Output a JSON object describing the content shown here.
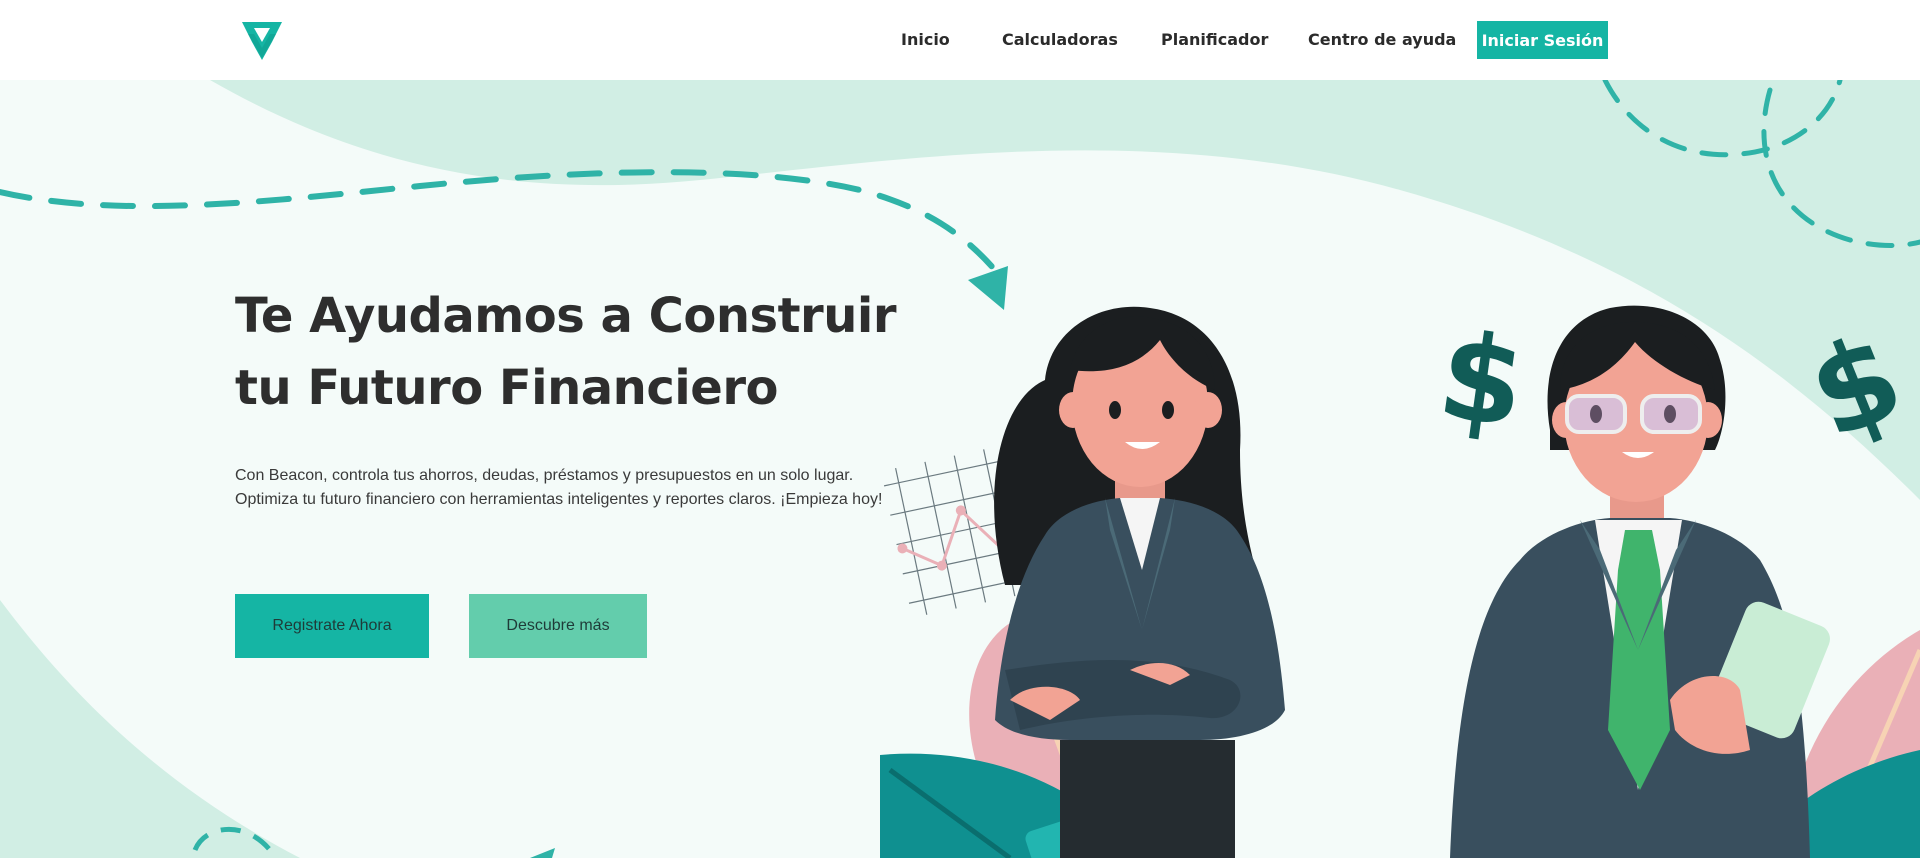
{
  "header": {
    "logo_icon": "beacon-v-logo-icon",
    "nav": [
      {
        "label": "Inicio"
      },
      {
        "label": "Calculadoras"
      },
      {
        "label": "Planificador"
      },
      {
        "label": "Centro de ayuda"
      }
    ],
    "login_label": "Iniciar Sesión"
  },
  "hero": {
    "title_line1": "Te Ayudamos a Construir",
    "title_line2": "tu Futuro Financiero",
    "description": "Con Beacon, controla tus ahorros, deudas, préstamos y presupuestos en un solo lugar. Optimiza tu futuro financiero con herramientas inteligentes y reportes claros. ¡Empieza hoy!",
    "primary_button": "Registrate Ahora",
    "secondary_button": "Descubre más"
  },
  "colors": {
    "accent": "#15b5a4",
    "secondary": "#63cdac",
    "mint_bg": "#d1eee4",
    "light_bg": "#f4fbf9",
    "dark_teal": "#115c57",
    "text": "#2e2e2e"
  },
  "icons": [
    "dashed-arrow-icon",
    "dollar-sign-icon",
    "line-chart-icon",
    "leaf-decoration-icon",
    "businesswoman-illustration",
    "businessman-illustration"
  ]
}
